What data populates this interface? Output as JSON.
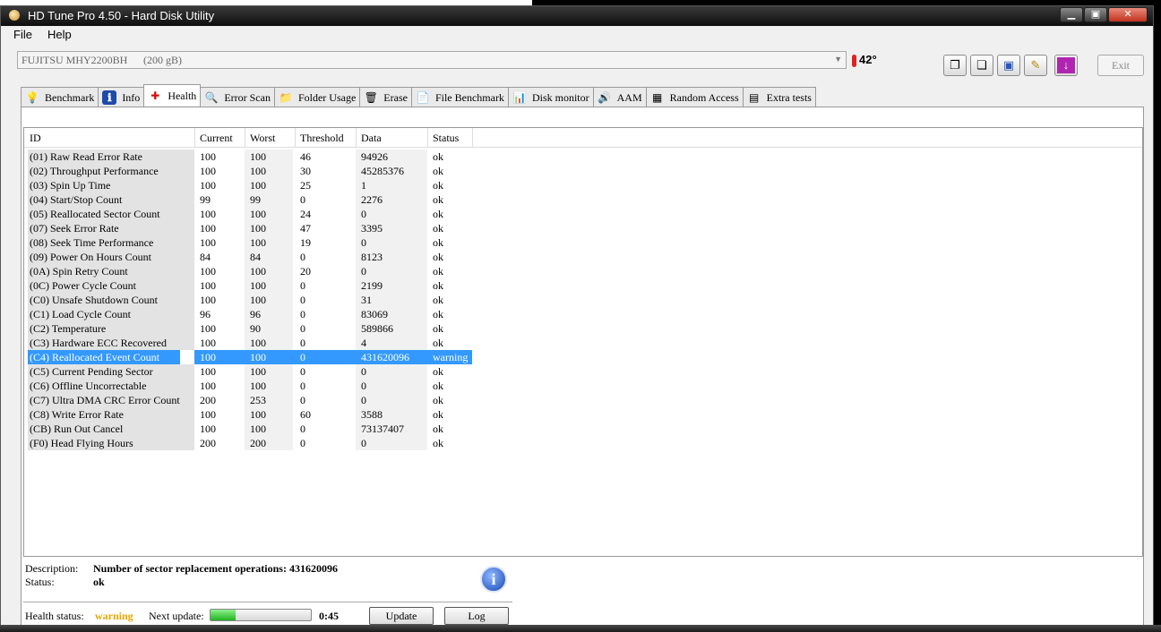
{
  "window": {
    "title": "HD Tune Pro 4.50 - Hard Disk Utility",
    "buttons": {
      "minimize": "▁",
      "maximize": "▣",
      "close": "✕"
    }
  },
  "menu": {
    "file": "File",
    "help": "Help"
  },
  "drive": {
    "name": "FUJITSU MHY2200BH",
    "size": "(200 gB)",
    "arrow": "▼"
  },
  "temperature": "42",
  "temperature_unit_glyph": "°",
  "exit_label": "Exit",
  "tabs": [
    {
      "label": "Benchmark",
      "icon": "lightbulb-icon",
      "glyph": "💡"
    },
    {
      "label": "Info",
      "icon": "info-icon",
      "glyph": "ℹ"
    },
    {
      "label": "Health",
      "icon": "red-cross-icon",
      "glyph": "✚"
    },
    {
      "label": "Error Scan",
      "icon": "magnifier-icon",
      "glyph": "🔍"
    },
    {
      "label": "Folder Usage",
      "icon": "folder-icon",
      "glyph": "📁"
    },
    {
      "label": "Erase",
      "icon": "trash-icon",
      "glyph": "🗑"
    },
    {
      "label": "File Benchmark",
      "icon": "file-benchmark-icon",
      "glyph": "📄"
    },
    {
      "label": "Disk monitor",
      "icon": "disk-monitor-icon",
      "glyph": "📊"
    },
    {
      "label": "AAM",
      "icon": "speaker-icon",
      "glyph": "🔊"
    },
    {
      "label": "Random Access",
      "icon": "random-access-icon",
      "glyph": "▦"
    },
    {
      "label": "Extra tests",
      "icon": "extra-tests-icon",
      "glyph": "▤"
    }
  ],
  "columns": [
    "ID",
    "Current",
    "Worst",
    "Threshold",
    "Data",
    "Status"
  ],
  "rows": [
    {
      "id": "(01) Raw Read Error Rate",
      "current": "100",
      "worst": "100",
      "threshold": "46",
      "data": "94926",
      "status": "ok"
    },
    {
      "id": "(02) Throughput Performance",
      "current": "100",
      "worst": "100",
      "threshold": "30",
      "data": "45285376",
      "status": "ok"
    },
    {
      "id": "(03) Spin Up Time",
      "current": "100",
      "worst": "100",
      "threshold": "25",
      "data": "1",
      "status": "ok"
    },
    {
      "id": "(04) Start/Stop Count",
      "current": "99",
      "worst": "99",
      "threshold": "0",
      "data": "2276",
      "status": "ok"
    },
    {
      "id": "(05) Reallocated Sector Count",
      "current": "100",
      "worst": "100",
      "threshold": "24",
      "data": "0",
      "status": "ok"
    },
    {
      "id": "(07) Seek Error Rate",
      "current": "100",
      "worst": "100",
      "threshold": "47",
      "data": "3395",
      "status": "ok"
    },
    {
      "id": "(08) Seek Time Performance",
      "current": "100",
      "worst": "100",
      "threshold": "19",
      "data": "0",
      "status": "ok"
    },
    {
      "id": "(09) Power On Hours Count",
      "current": "84",
      "worst": "84",
      "threshold": "0",
      "data": "8123",
      "status": "ok"
    },
    {
      "id": "(0A) Spin Retry Count",
      "current": "100",
      "worst": "100",
      "threshold": "20",
      "data": "0",
      "status": "ok"
    },
    {
      "id": "(0C) Power Cycle Count",
      "current": "100",
      "worst": "100",
      "threshold": "0",
      "data": "2199",
      "status": "ok"
    },
    {
      "id": "(C0) Unsafe Shutdown Count",
      "current": "100",
      "worst": "100",
      "threshold": "0",
      "data": "31",
      "status": "ok"
    },
    {
      "id": "(C1) Load Cycle Count",
      "current": "96",
      "worst": "96",
      "threshold": "0",
      "data": "83069",
      "status": "ok"
    },
    {
      "id": "(C2) Temperature",
      "current": "100",
      "worst": "90",
      "threshold": "0",
      "data": "589866",
      "status": "ok"
    },
    {
      "id": "(C3) Hardware ECC Recovered",
      "current": "100",
      "worst": "100",
      "threshold": "0",
      "data": "4",
      "status": "ok"
    },
    {
      "id": "(C4) Reallocated Event Count",
      "current": "100",
      "worst": "100",
      "threshold": "0",
      "data": "431620096",
      "status": "warning"
    },
    {
      "id": "(C5) Current Pending Sector",
      "current": "100",
      "worst": "100",
      "threshold": "0",
      "data": "0",
      "status": "ok"
    },
    {
      "id": "(C6) Offline Uncorrectable",
      "current": "100",
      "worst": "100",
      "threshold": "0",
      "data": "0",
      "status": "ok"
    },
    {
      "id": "(C7) Ultra DMA CRC Error Count",
      "current": "200",
      "worst": "253",
      "threshold": "0",
      "data": "0",
      "status": "ok"
    },
    {
      "id": "(C8) Write Error Rate",
      "current": "100",
      "worst": "100",
      "threshold": "60",
      "data": "3588",
      "status": "ok"
    },
    {
      "id": "(CB) Run Out Cancel",
      "current": "100",
      "worst": "100",
      "threshold": "0",
      "data": "73137407",
      "status": "ok"
    },
    {
      "id": "(F0) Head Flying Hours",
      "current": "200",
      "worst": "200",
      "threshold": "0",
      "data": "0",
      "status": "ok"
    }
  ],
  "selected_row": 14,
  "description": {
    "label": "Description:",
    "value": "Number of sector replacement operations: 431620096",
    "status_label": "Status:",
    "status_value": "ok"
  },
  "health": {
    "label": "Health status:",
    "value": "warning",
    "next_update_label": "Next update:",
    "progress_fraction": 0.25,
    "countdown": "0:45",
    "update_button": "Update",
    "log_button": "Log"
  },
  "colors": {
    "selection": "#3399ff",
    "warning": "#e0a800"
  }
}
